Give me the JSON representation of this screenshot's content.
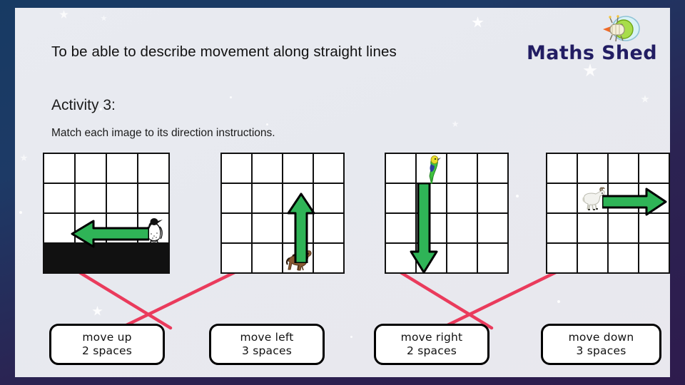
{
  "slide": {
    "title": "To be able to describe movement along straight lines",
    "activity_heading": "Activity 3:",
    "instruction": "Match each image to its direction instructions.",
    "brand": {
      "name": "Maths Shed",
      "mark": "rocket-bug-logo",
      "color": "#221d63"
    },
    "frame_color_top": "#173a63",
    "frame_color_bottom": "#2e1b4d",
    "background_color": "#e9ebf1"
  },
  "grids": [
    {
      "id": "grid-1",
      "rows": 4,
      "cols": 4,
      "sprite": {
        "name": "penguin",
        "row": 3,
        "col": 4
      },
      "arrow": {
        "direction": "left",
        "color": "#2fb457",
        "row": 3,
        "from_col": 4,
        "to_col": 2,
        "spaces": 3
      }
    },
    {
      "id": "grid-2",
      "rows": 4,
      "cols": 4,
      "sprite": {
        "name": "horse",
        "row": 4,
        "col": 3
      },
      "arrow": {
        "direction": "up",
        "color": "#2fb457",
        "col": 3,
        "from_row": 4,
        "to_row": 2,
        "spaces": 2
      }
    },
    {
      "id": "grid-3",
      "rows": 4,
      "cols": 4,
      "sprite": {
        "name": "parrot",
        "row": 1,
        "col": 2
      },
      "arrow": {
        "direction": "down",
        "color": "#2fb457",
        "col": 2,
        "from_row": 1,
        "to_row": 4,
        "spaces": 3
      }
    },
    {
      "id": "grid-4",
      "rows": 4,
      "cols": 4,
      "sprite": {
        "name": "goat",
        "row": 2,
        "col": 2
      },
      "arrow": {
        "direction": "right",
        "color": "#2fb457",
        "row": 2,
        "from_col": 2,
        "to_col": 4,
        "spaces": 2
      }
    }
  ],
  "answer_boxes": [
    {
      "id": "box-1",
      "line1": "move up",
      "line2": "2 spaces"
    },
    {
      "id": "box-2",
      "line1": "move left",
      "line2": "3 spaces"
    },
    {
      "id": "box-3",
      "line1": "move right",
      "line2": "2 spaces"
    },
    {
      "id": "box-4",
      "line1": "move down",
      "line2": "3 spaces"
    }
  ],
  "connections": {
    "color": "#ea3b5c",
    "links": [
      {
        "from": "grid-1",
        "to": "box-2"
      },
      {
        "from": "grid-2",
        "to": "box-1"
      },
      {
        "from": "grid-3",
        "to": "box-4"
      },
      {
        "from": "grid-4",
        "to": "box-3"
      }
    ]
  }
}
